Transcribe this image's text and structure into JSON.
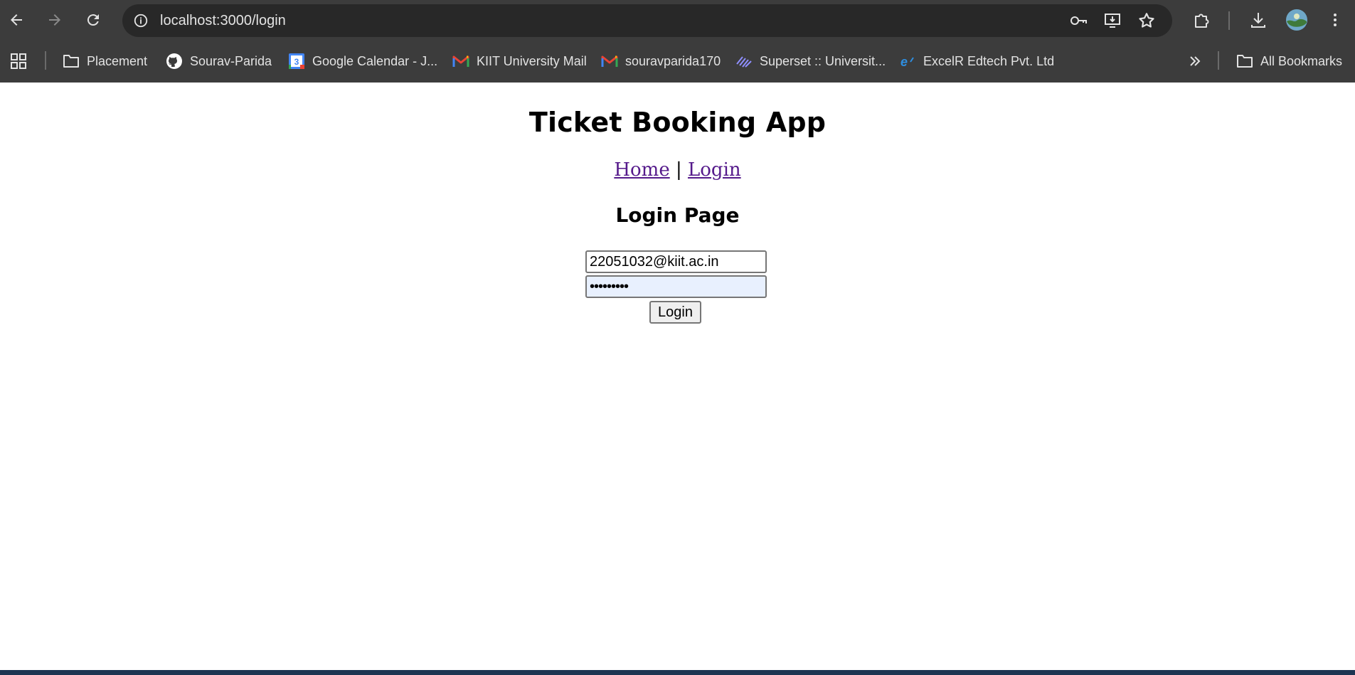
{
  "browser": {
    "url": "localhost:3000/login",
    "bookmarks": [
      {
        "label": "Placement",
        "icon": "folder-icon"
      },
      {
        "label": "Sourav-Parida",
        "icon": "github-icon"
      },
      {
        "label": "Google Calendar - J...",
        "icon": "calendar-icon",
        "badge": "3"
      },
      {
        "label": "KIIT University Mail",
        "icon": "gmail-icon"
      },
      {
        "label": "souravparida170",
        "icon": "gmail-icon"
      },
      {
        "label": "Superset :: Universit...",
        "icon": "superset-icon"
      },
      {
        "label": "ExcelR Edtech Pvt. Ltd",
        "icon": "excelr-icon"
      }
    ],
    "all_bookmarks_label": "All Bookmarks"
  },
  "page": {
    "title": "Ticket Booking App",
    "nav": {
      "home": "Home",
      "separator": "|",
      "login": "Login"
    },
    "subtitle": "Login Page",
    "form": {
      "email_value": "22051032@kiit.ac.in",
      "password_value": "•••••••••",
      "submit_label": "Login"
    }
  },
  "colors": {
    "chrome_bg": "#3c3c3c",
    "omnibox_bg": "#282828",
    "visited_link": "#551a8b",
    "autofill_bg": "#e8f0fe"
  }
}
